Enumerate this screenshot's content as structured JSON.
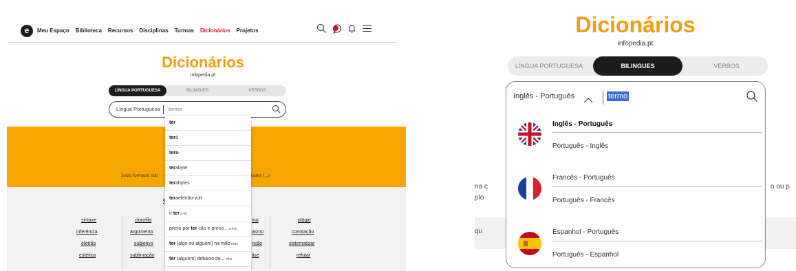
{
  "left": {
    "nav": {
      "logo": "e",
      "links": [
        "Meu Espaço",
        "Biblioteca",
        "Recursos",
        "Disciplinas",
        "Turmas",
        "Dicionários",
        "Projetos"
      ],
      "active_link": "Dicionários",
      "icons": [
        "search-icon",
        "chat-notification-icon",
        "bell-icon",
        "menu-icon"
      ]
    },
    "title": "Dicionários",
    "subtitle": "infopedia.pt",
    "tabs": [
      {
        "label": "LÍNGUA PORTUGUESA",
        "active": true
      },
      {
        "label": "BILINGUES",
        "active": false
      },
      {
        "label": "VERBOS",
        "active": false
      }
    ],
    "search": {
      "language": "Língua Portuguesa",
      "value": "termo"
    },
    "band_left_text": "Juízo formado sob",
    "band_right_text": "lades (...)",
    "section_letter": "S",
    "words": [
      [
        "sintaxe",
        "inferência",
        "eletrão",
        "estética"
      ],
      [
        "clorofila",
        "argumento",
        "subjetivo",
        "sublimação"
      ],
      [
        "ma",
        "asmo",
        "nsão",
        "lise"
      ],
      [
        "plágio",
        "conotação",
        "sistematizar",
        "refutar"
      ]
    ],
    "dropdown": [
      {
        "bold": "ter",
        "rest": "",
        "small": ""
      },
      {
        "bold": "ter",
        "rest": "á",
        "small": ""
      },
      {
        "bold": "tera",
        "rest": "-",
        "small": ""
      },
      {
        "bold": "ter",
        "rest": "abyte",
        "small": ""
      },
      {
        "bold": "ter",
        "rest": "abytes",
        "small": ""
      },
      {
        "bold": "ter",
        "rest": "aeletrão-volt",
        "small": ""
      },
      {
        "pre": "ir ",
        "bold": "ter",
        "rest": "",
        "small": " a ter"
      },
      {
        "pre": "preso por ",
        "bold": "ter",
        "rest": " cão e preso...",
        "small": " preso"
      },
      {
        "pre": "",
        "bold": "ter",
        "rest": " (algo ou alguém) na mão",
        "small": " mão"
      },
      {
        "pre": "",
        "bold": "ter",
        "rest": " (alguém) debaixo de...",
        "small": " olho"
      }
    ]
  },
  "right": {
    "title": "Dicionários",
    "subtitle": "infopedia.pt",
    "tabs": [
      {
        "label": "LÍNGUA PORTUGUESA",
        "active": false
      },
      {
        "label": "BILINGUES",
        "active": true
      },
      {
        "label": "VERBOS",
        "active": false
      }
    ],
    "search": {
      "language": "Inglês - Português",
      "value": "termo"
    },
    "groups": [
      {
        "flag": "uk-flag-icon",
        "items": [
          {
            "label": "Inglês - Português",
            "bold": true
          },
          {
            "label": "Português - Inglês",
            "bold": false
          }
        ]
      },
      {
        "flag": "france-flag-icon",
        "items": [
          {
            "label": "Francês - Português",
            "bold": false
          },
          {
            "label": "Português - Francês",
            "bold": false
          }
        ]
      },
      {
        "flag": "spain-flag-icon",
        "items": [
          {
            "label": "Espanhol - Português",
            "bold": false
          },
          {
            "label": "Português - Espanhol",
            "bold": false
          }
        ]
      }
    ],
    "edge_text": {
      "left_1": "na c",
      "left_2": "plo",
      "left_3": "qu",
      "right_1": "o ou p"
    }
  },
  "colors": {
    "accent_orange": "#f39c12",
    "band_orange": "#f7a500",
    "active_red": "#d4182b",
    "dark": "#1c1c1c",
    "highlight_blue": "#2f6fd6"
  }
}
